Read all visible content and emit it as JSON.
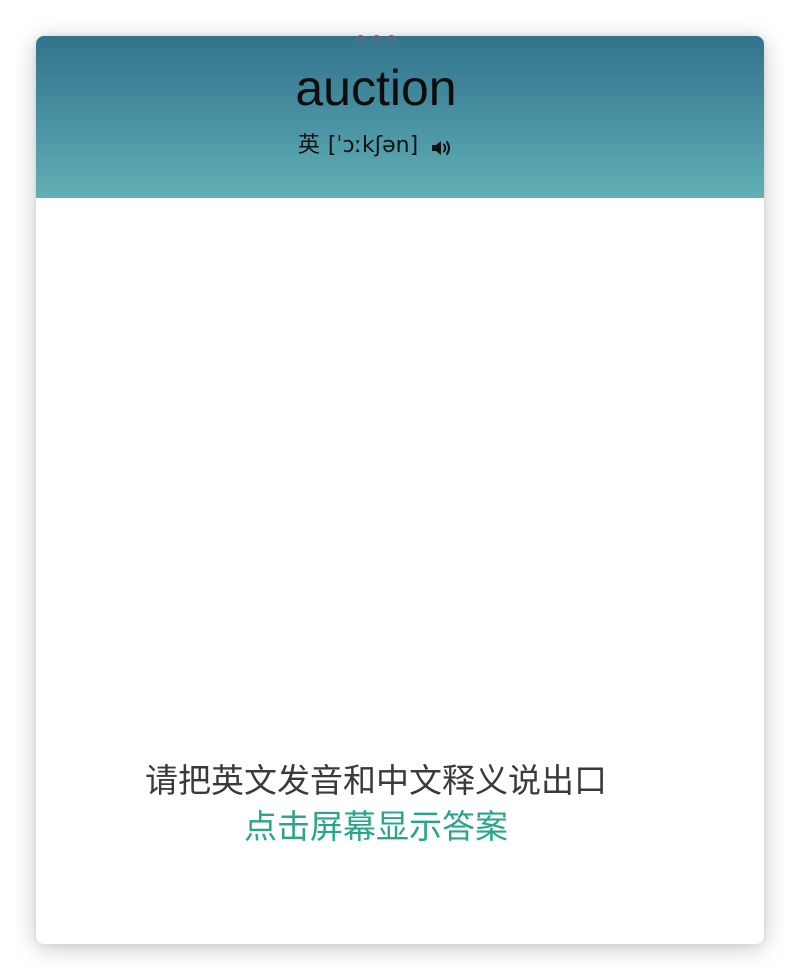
{
  "card": {
    "word": "auction",
    "accent_label": "英",
    "phonetic": "[ˈɔːkʃən]",
    "speaker_icon": "speaker-icon",
    "prompt": "请把英文发音和中文释义说出口",
    "reveal_hint": "点击屏幕显示答案"
  },
  "colors": {
    "header_top": "#32738c",
    "header_bottom": "#62b0b4",
    "reveal_text": "#2aa58a",
    "prompt_text": "#3a3a3a"
  }
}
